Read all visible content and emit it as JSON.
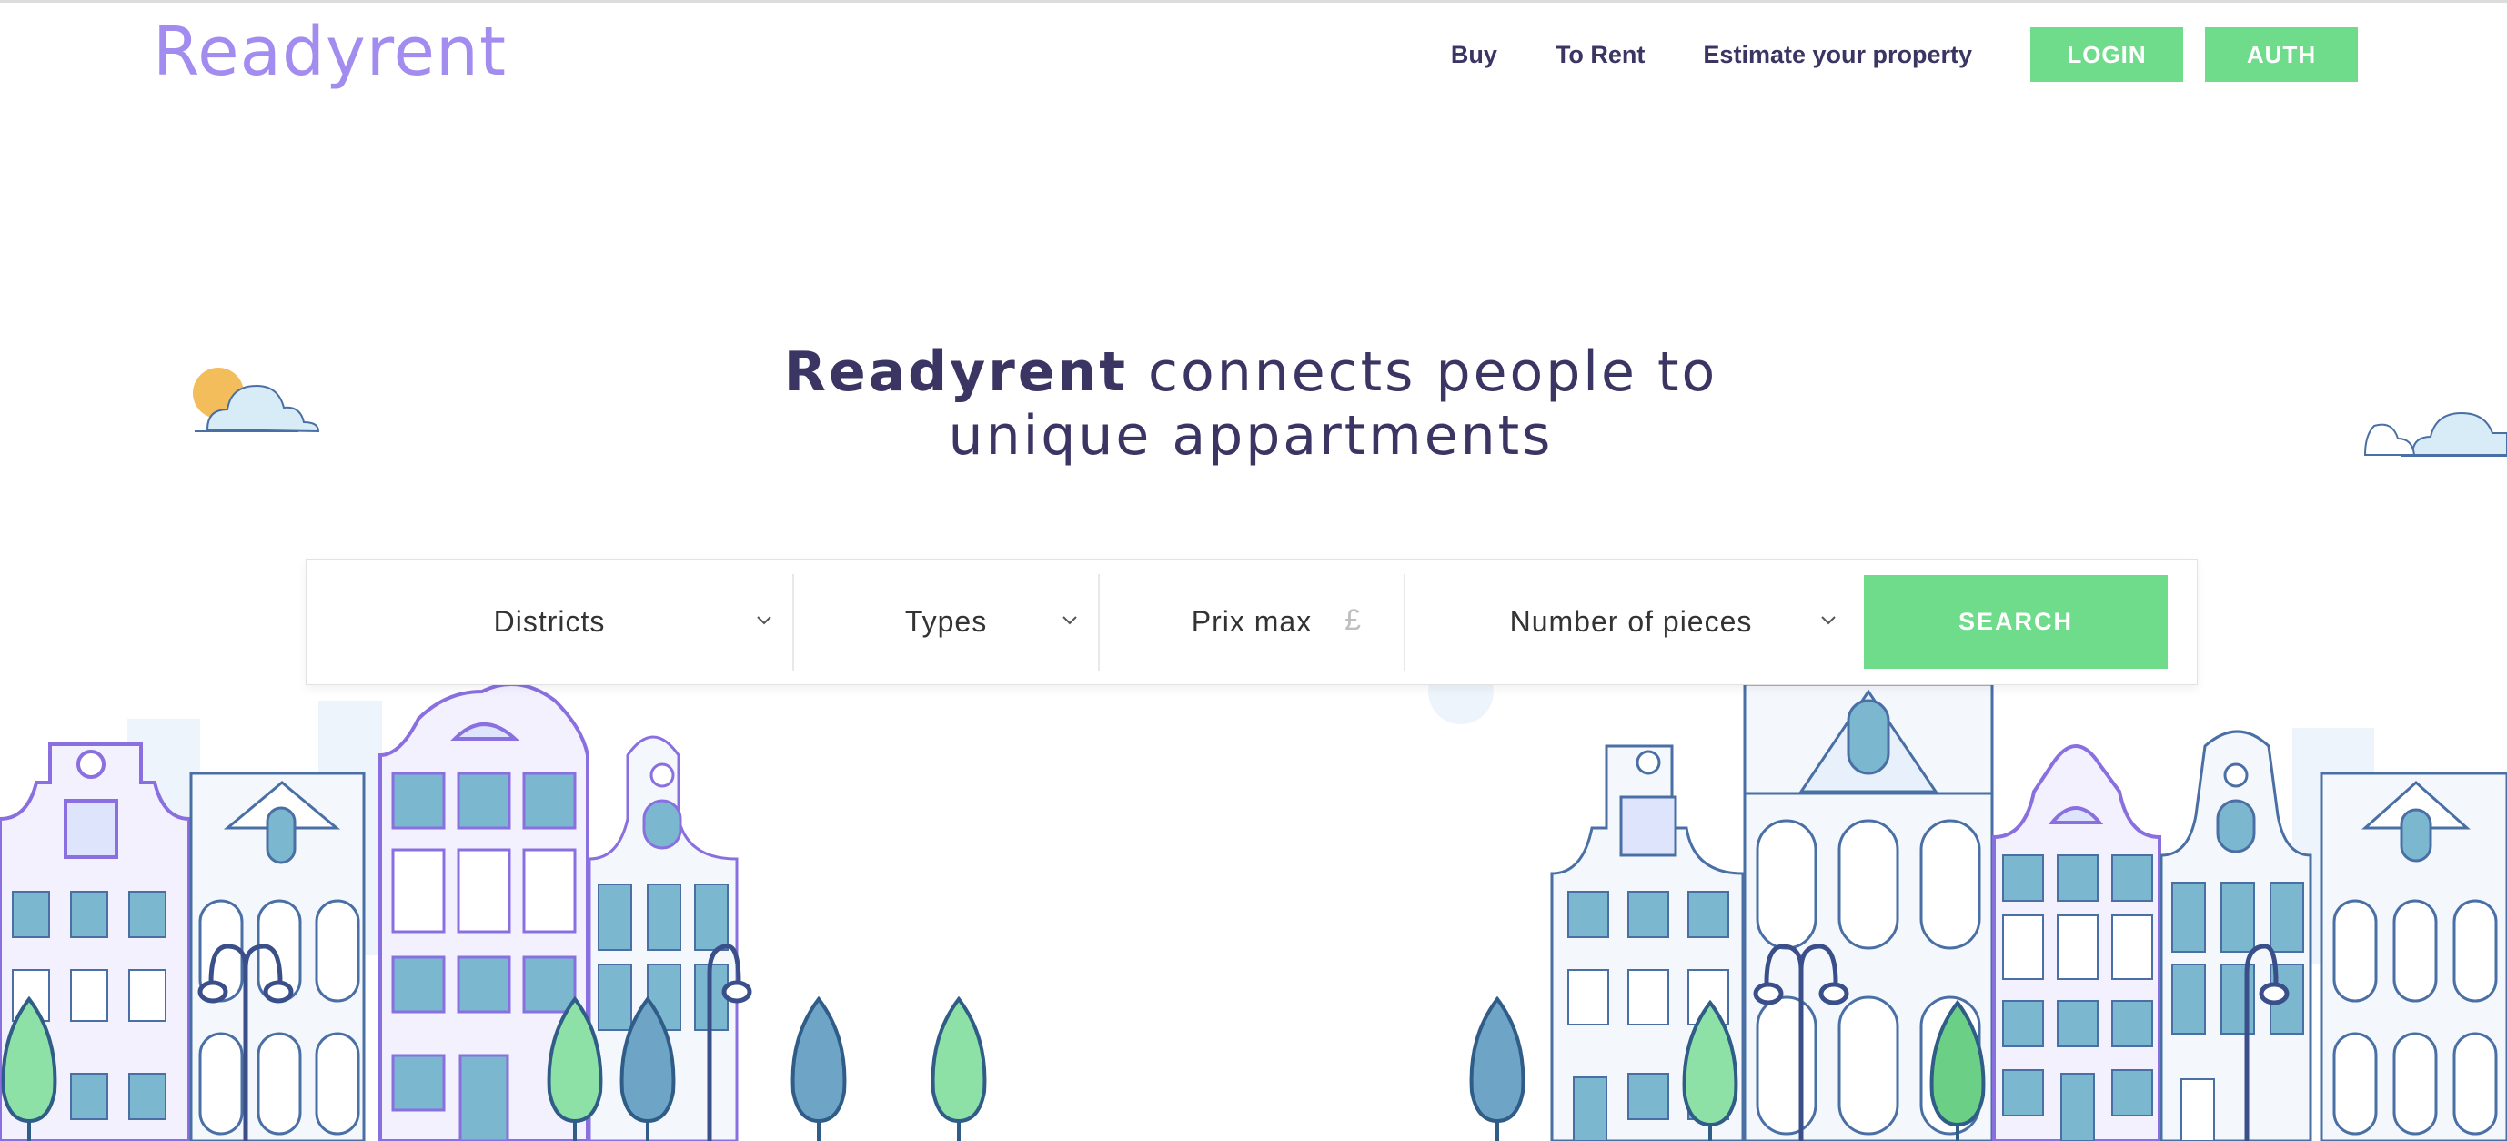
{
  "brand": {
    "logo_text": "Readyrent"
  },
  "nav": {
    "links": [
      "Buy",
      "To Rent",
      "Estimate your property"
    ],
    "login_label": "LOGIN",
    "auth_label": "AUTH"
  },
  "hero": {
    "title_bold": "Readyrent",
    "title_rest": " connects people to unique appartments"
  },
  "search": {
    "districts_label": "Districts",
    "types_label": "Types",
    "price_label": "Prix max",
    "price_currency": "£",
    "pieces_label": "Number of pieces",
    "button_label": "SEARCH"
  },
  "colors": {
    "accent_green": "#6fdc8c",
    "logo_purple": "#a38cf0",
    "text_dark": "#3b3563",
    "sun": "#f3bd5c"
  },
  "icons": [
    "chevron-down-icon",
    "sun-icon",
    "cloud-icon",
    "tree-icon",
    "street-lamp-icon"
  ]
}
